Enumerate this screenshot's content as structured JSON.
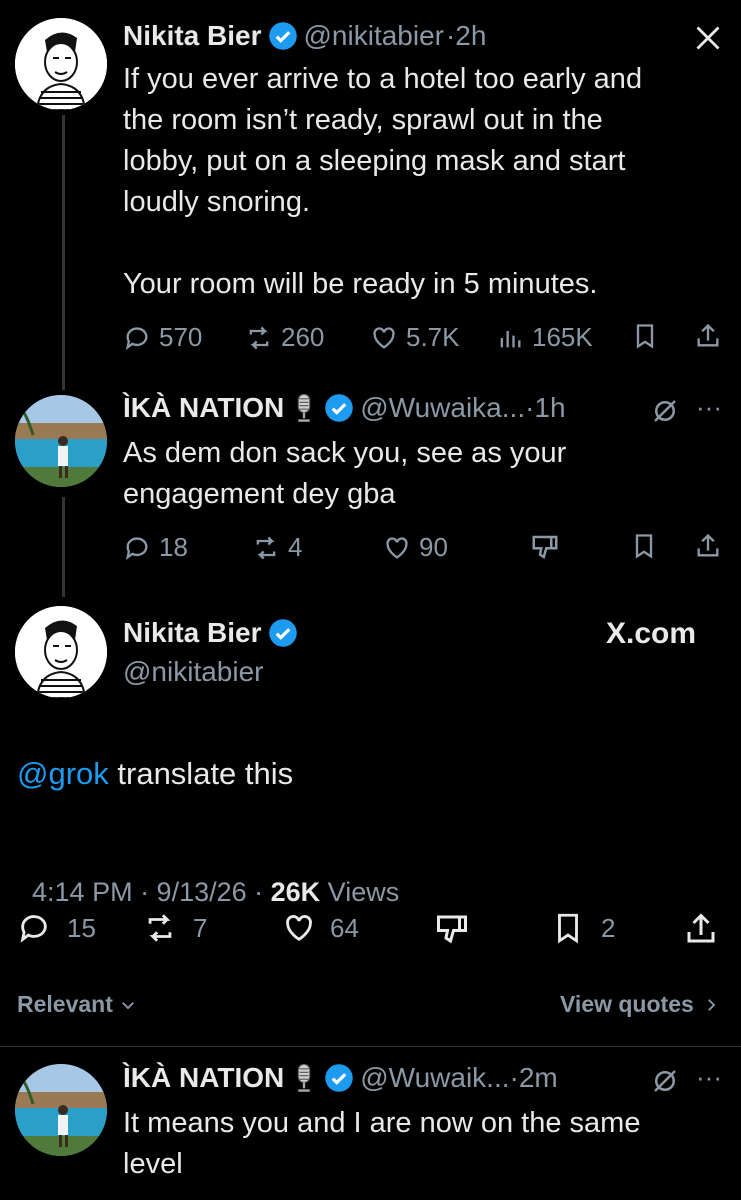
{
  "tweet1": {
    "name": "Nikita Bier",
    "handle": "@nikitabier",
    "time": "·2h",
    "text": "If you ever arrive to a hotel too early and\nthe room isn’t ready, sprawl out in the\nlobby, put on a sleeping mask and start\nloudly snoring.\n\nYour room will be ready in 5 minutes.",
    "replies": "570",
    "reposts": "260",
    "likes": "5.7K",
    "views": "165K",
    "corner_icon": "x-logo-icon"
  },
  "tweet2": {
    "name": "ÌKÀ NATION",
    "handle": "@Wuwaika...",
    "time": "·1h",
    "text": "As dem don sack you, see as your\nengagement dey gba",
    "replies": "18",
    "reposts": "4",
    "likes": "90"
  },
  "main": {
    "name": "Nikita Bier",
    "handle": "@nikitabier",
    "source": "X.com",
    "mention": "@grok",
    "text": " translate this",
    "time": "4:14 PM · 9/13/26 · ",
    "views_count": "26K",
    "views_label": " Views",
    "replies": "15",
    "reposts": "7",
    "likes": "64",
    "bookmarks": "2"
  },
  "sort": {
    "relevant_label": "Relevant",
    "view_quotes_label": "View quotes"
  },
  "reply": {
    "name": "ÌKÀ NATION",
    "handle": "@Wuwaik...",
    "time": "·2m",
    "text": "It means you and I are now on the same\nlevel"
  },
  "colors": {
    "link": "#1d9bf0",
    "muted": "#8b98a5",
    "verified": "#1d9bf0"
  }
}
